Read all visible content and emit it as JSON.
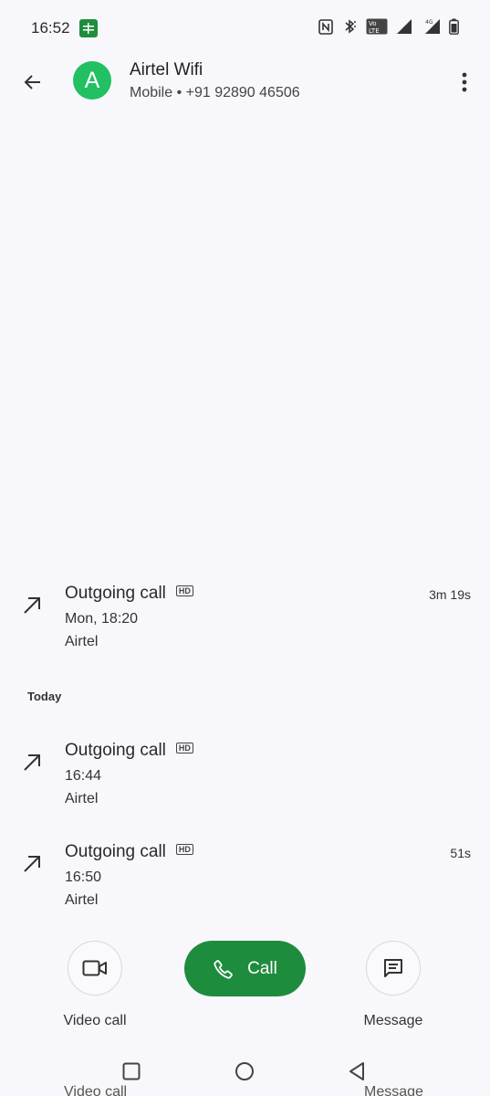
{
  "status_bar": {
    "time": "16:52",
    "notification_icon": "sheets-icon",
    "right_icons": [
      "nfc-icon",
      "bluetooth-icon",
      "volte-icon",
      "signal-icon",
      "4g-signal-icon",
      "battery-icon"
    ]
  },
  "header": {
    "avatar_letter": "A",
    "avatar_color": "#21c063",
    "name": "Airtel Wifi",
    "subtitle": "Mobile • +91 92890 46506"
  },
  "calls": [
    {
      "type": "Outgoing call",
      "hd": "HD",
      "time": "Mon, 18:20",
      "sim": "Airtel",
      "duration": "3m 19s"
    },
    {
      "type": "Outgoing call",
      "hd": "HD",
      "time": "16:44",
      "sim": "Airtel",
      "duration": ""
    },
    {
      "type": "Outgoing call",
      "hd": "HD",
      "time": "16:50",
      "sim": "Airtel",
      "duration": "51s"
    }
  ],
  "section": {
    "today": "Today"
  },
  "actions": {
    "video_call_label": "Video call",
    "call_label": "Call",
    "message_label": "Message",
    "call_color": "#1e8c3d"
  }
}
